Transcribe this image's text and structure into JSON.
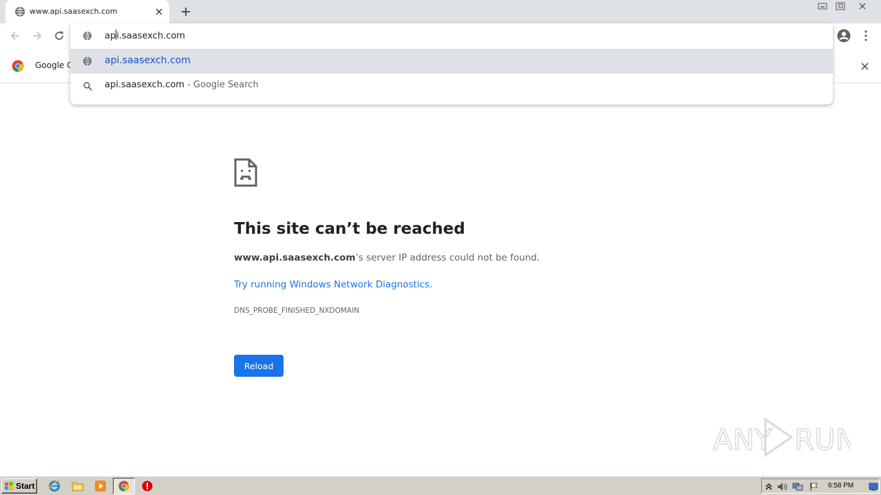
{
  "tab": {
    "title": "www.api.saasexch.com",
    "favicon": "globe-icon"
  },
  "omnibox": {
    "input_before_caret": "ap",
    "input_after_caret": "i.saasexch.com",
    "suggestions": [
      {
        "icon": "globe-icon",
        "text": "api.saasexch.com",
        "suffix": ""
      },
      {
        "icon": "search-icon",
        "text": "api.saasexch.com",
        "suffix": " - Google Search"
      }
    ]
  },
  "infobar": {
    "text": "Google Cl"
  },
  "error": {
    "title": "This site can’t be reached",
    "host": "www.api.saasexch.com",
    "desc_rest": "’s server IP address could not be found.",
    "link": "Try running Windows Network Diagnostics.",
    "code": "DNS_PROBE_FINISHED_NXDOMAIN",
    "reload_label": "Reload"
  },
  "watermark": {
    "text_left": "ANY",
    "text_right": "RUN"
  },
  "taskbar": {
    "start_label": "Start",
    "clock": "6:58 PM"
  },
  "colors": {
    "accent": "#1a73e8",
    "tabstrip": "#dee1e6",
    "taskbar": "#d4d0c8"
  }
}
